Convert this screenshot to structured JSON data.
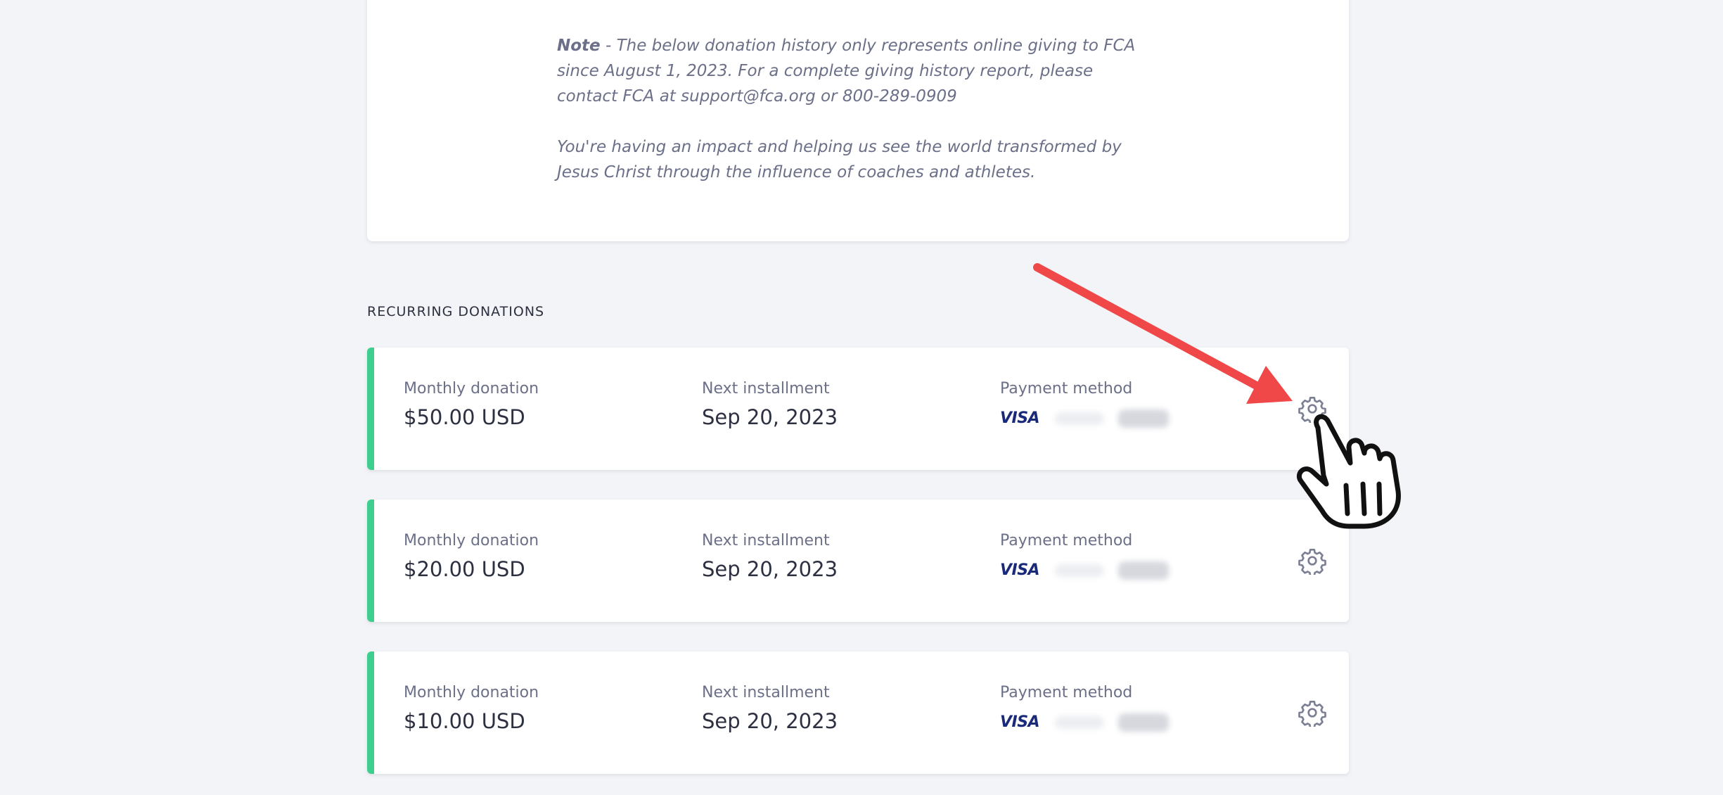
{
  "note": {
    "note_label": "Note",
    "note_text": " - The below donation history only represents online giving to FCA since August 1, 2023.  For a complete giving history report, please contact FCA at support@fca.org or 800-289-0909",
    "impact_text": "You're having an impact and helping us see the world transformed by Jesus Christ through the influence of coaches and athletes."
  },
  "recurring": {
    "section_title": "RECURRING DONATIONS",
    "accent_color": "#3ecf8e",
    "items": [
      {
        "amount_label": "Monthly donation",
        "amount": "$50.00 USD",
        "next_label": "Next installment",
        "next_date": "Sep 20, 2023",
        "payment_label": "Payment method",
        "card_brand": "VISA",
        "settings_icon": "gear-icon"
      },
      {
        "amount_label": "Monthly donation",
        "amount": "$20.00 USD",
        "next_label": "Next installment",
        "next_date": "Sep 20, 2023",
        "payment_label": "Payment method",
        "card_brand": "VISA",
        "settings_icon": "gear-icon"
      },
      {
        "amount_label": "Monthly donation",
        "amount": "$10.00 USD",
        "next_label": "Next installment",
        "next_date": "Sep 20, 2023",
        "payment_label": "Payment method",
        "card_brand": "VISA",
        "settings_icon": "gear-icon"
      }
    ]
  },
  "annotation": {
    "arrow_color": "#f04848",
    "cursor_icon": "hand-pointer-icon"
  }
}
